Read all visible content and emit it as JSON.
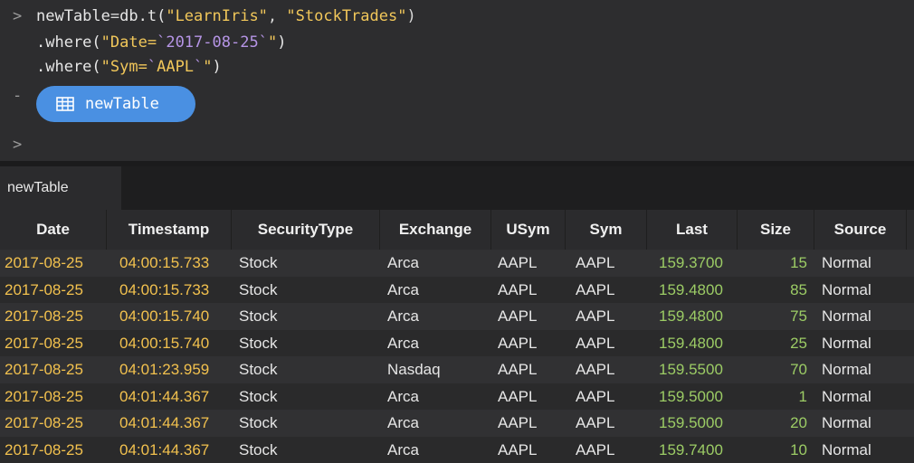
{
  "console": {
    "prompt_symbol": ">",
    "result_dash": "-",
    "line1": {
      "ident": "newTable",
      "eq": "=",
      "obj": "db.t(",
      "str1": "\"LearnIris\"",
      "comma": ", ",
      "str2": "\"StockTrades\"",
      "close": ")"
    },
    "line2": {
      "pre": ".where(",
      "s1": "\"Date=",
      "t1": "`",
      "val": "2017-08-25",
      "t2": "`",
      "s2": "\"",
      "close": ")"
    },
    "line3": {
      "pre": ".where(",
      "s1": "\"Sym=",
      "t1": "`",
      "val": "AAPL",
      "t2": "`",
      "s2": "\"",
      "close": ")"
    },
    "result_button_label": "newTable",
    "empty_prompt": ">"
  },
  "tabs": [
    {
      "label": "newTable"
    }
  ],
  "table": {
    "columns": [
      "Date",
      "Timestamp",
      "SecurityType",
      "Exchange",
      "USym",
      "Sym",
      "Last",
      "Size",
      "Source"
    ],
    "rows": [
      [
        "2017-08-25",
        "04:00:15.733",
        "Stock",
        "Arca",
        "AAPL",
        "AAPL",
        "159.3700",
        "15",
        "Normal"
      ],
      [
        "2017-08-25",
        "04:00:15.733",
        "Stock",
        "Arca",
        "AAPL",
        "AAPL",
        "159.4800",
        "85",
        "Normal"
      ],
      [
        "2017-08-25",
        "04:00:15.740",
        "Stock",
        "Arca",
        "AAPL",
        "AAPL",
        "159.4800",
        "75",
        "Normal"
      ],
      [
        "2017-08-25",
        "04:00:15.740",
        "Stock",
        "Arca",
        "AAPL",
        "AAPL",
        "159.4800",
        "25",
        "Normal"
      ],
      [
        "2017-08-25",
        "04:01:23.959",
        "Stock",
        "Nasdaq",
        "AAPL",
        "AAPL",
        "159.5500",
        "70",
        "Normal"
      ],
      [
        "2017-08-25",
        "04:01:44.367",
        "Stock",
        "Arca",
        "AAPL",
        "AAPL",
        "159.5000",
        "1",
        "Normal"
      ],
      [
        "2017-08-25",
        "04:01:44.367",
        "Stock",
        "Arca",
        "AAPL",
        "AAPL",
        "159.5000",
        "20",
        "Normal"
      ],
      [
        "2017-08-25",
        "04:01:44.367",
        "Stock",
        "Arca",
        "AAPL",
        "AAPL",
        "159.7400",
        "10",
        "Normal"
      ]
    ]
  },
  "colors": {
    "accent": "#4a90e2",
    "date": "#f2c14e",
    "number": "#9ccc65",
    "string": "#f1c75a",
    "backtick": "#b695e6"
  },
  "icons": {
    "result": "table-grid-icon"
  }
}
